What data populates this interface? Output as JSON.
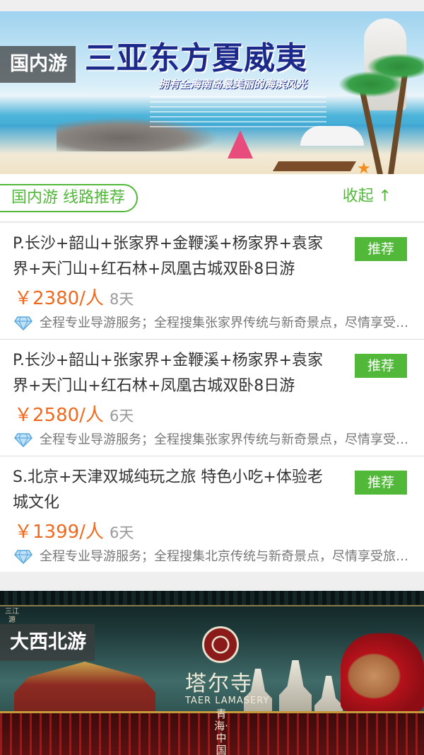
{
  "banners": [
    {
      "region_tag": "国内游",
      "title": "三亚东方夏威夷",
      "subtitle": "拥有全海南岛最美丽的海滨风光"
    },
    {
      "region_tag": "大西北游",
      "title": "塔尔寺",
      "subtitle_en": "TAER LAMASERY",
      "vertical_text": "青海·中国",
      "side_text": "三江源"
    }
  ],
  "section": {
    "title": "国内游 线路推荐",
    "collapse_label": "收起 ↑"
  },
  "routes": [
    {
      "title": "P.长沙+韶山+张家界+金鞭溪+杨家界+袁家界+天门山+红石林+凤凰古城双卧8日游",
      "badge": "推荐",
      "price": "￥2380/人",
      "days": "8天",
      "description": "全程专业导游服务；全程搜集张家界传统与新奇景点，尽情享受旅游乐趣"
    },
    {
      "title": "P.长沙+韶山+张家界+金鞭溪+杨家界+袁家界+天门山+红石林+凤凰古城双卧8日游",
      "badge": "推荐",
      "price": "￥2580/人",
      "days": "6天",
      "description": "全程专业导游服务；全程搜集张家界传统与新奇景点，尽情享受旅游乐趣"
    },
    {
      "title": "S.北京+天津双城纯玩之旅 特色小吃+体验老城文化",
      "badge": "推荐",
      "price": "￥1399/人",
      "days": "6天",
      "description": "全程专业导游服务；全程搜集北京传统与新奇景点，尽情享受旅游乐趣"
    }
  ],
  "icons": {
    "route_feature": "diamond-icon"
  },
  "colors": {
    "accent_green": "#52b83a",
    "price_orange": "#f06a1e"
  }
}
